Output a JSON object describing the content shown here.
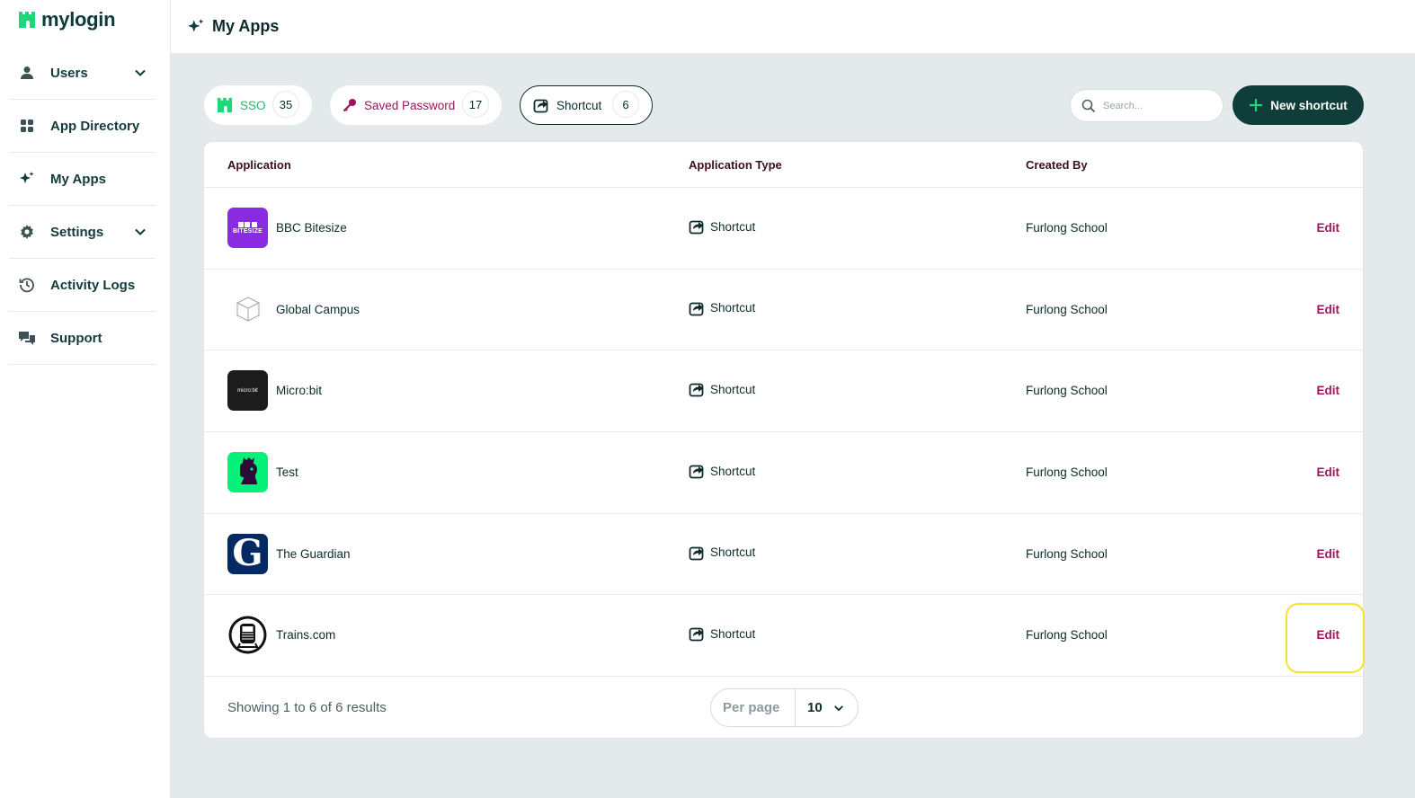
{
  "brand": {
    "name": "mylogin",
    "color": "#1fd67a"
  },
  "sidebar": {
    "items": [
      {
        "label": "Users",
        "icon": "user-icon",
        "has_chevron": true
      },
      {
        "label": "App Directory",
        "icon": "grid-icon",
        "has_chevron": false
      },
      {
        "label": "My Apps",
        "icon": "sparkles-icon",
        "has_chevron": false
      },
      {
        "label": "Settings",
        "icon": "gear-icon",
        "has_chevron": true
      },
      {
        "label": "Activity Logs",
        "icon": "history-icon",
        "has_chevron": false
      },
      {
        "label": "Support",
        "icon": "chat-bubbles-icon",
        "has_chevron": false
      }
    ]
  },
  "header": {
    "title": "My Apps",
    "icon": "sparkles-icon"
  },
  "tabs": [
    {
      "label": "SSO",
      "count": "35",
      "icon": "castle-icon",
      "color": "#1fb86a",
      "active": false
    },
    {
      "label": "Saved Password",
      "count": "17",
      "icon": "key-icon",
      "color": "#a0135f",
      "active": false
    },
    {
      "label": "Shortcut",
      "count": "6",
      "icon": "share-icon",
      "color": "#0c2b2b",
      "active": true
    }
  ],
  "search": {
    "placeholder": "Search...",
    "value": ""
  },
  "new_button": {
    "label": "New shortcut"
  },
  "table": {
    "headers": [
      "Application",
      "Application Type",
      "Created By"
    ],
    "rows": [
      {
        "name": "BBC Bitesize",
        "type": "Shortcut",
        "created_by": "Furlong School",
        "action": "Edit",
        "logo": "bbc-bitesize-logo",
        "logo_text": "BITESIZE"
      },
      {
        "name": "Global Campus",
        "type": "Shortcut",
        "created_by": "Furlong School",
        "action": "Edit",
        "logo": "cube-outline-logo",
        "logo_text": ""
      },
      {
        "name": "Micro:bit",
        "type": "Shortcut",
        "created_by": "Furlong School",
        "action": "Edit",
        "logo": "microbit-logo",
        "logo_text": "micro:bit"
      },
      {
        "name": "Test",
        "type": "Shortcut",
        "created_by": "Furlong School",
        "action": "Edit",
        "logo": "lion-logo",
        "logo_text": ""
      },
      {
        "name": "The Guardian",
        "type": "Shortcut",
        "created_by": "Furlong School",
        "action": "Edit",
        "logo": "guardian-logo",
        "logo_text": "G"
      },
      {
        "name": "Trains.com",
        "type": "Shortcut",
        "created_by": "Furlong School",
        "action": "Edit",
        "logo": "train-logo",
        "logo_text": ""
      }
    ]
  },
  "footer": {
    "showing": "Showing 1 to 6 of 6 results",
    "per_page_label": "Per page",
    "per_page_value": "10"
  }
}
